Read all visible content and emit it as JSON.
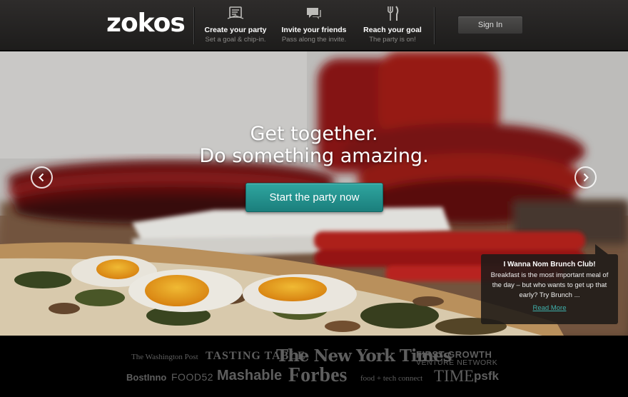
{
  "header": {
    "logo": "zokos",
    "signin_label": "Sign In",
    "steps": [
      {
        "title": "Create your party",
        "subtitle": "Set a goal & chip-in.",
        "icon": "receipt-icon"
      },
      {
        "title": "Invite your friends",
        "subtitle": "Pass along the invite.",
        "icon": "chat-bubble-icon"
      },
      {
        "title": "Reach your goal",
        "subtitle": "The party is on!",
        "icon": "fork-knife-icon"
      }
    ]
  },
  "hero": {
    "headline_line1": "Get together.",
    "headline_line2": "Do something amazing.",
    "cta_label": "Start the party now",
    "popup": {
      "title": "I Wanna Nom Brunch Club!",
      "body": "Breakfast is the most important meal of the day – but who wants to get up that early? Try Brunch ...",
      "link": "Read More"
    }
  },
  "press": {
    "washington_post": "The Washington Post",
    "tasting_table": "TASTING TABLE",
    "nyt": "The New York Times",
    "first_growth_1": "FIRST GROWTH",
    "first_growth_2": "VENTURE NETWORK",
    "bostinno": "BostInno",
    "food52": "FOOD52",
    "mashable": "Mashable",
    "forbes": "Forbes",
    "food_tech": "food + tech connect",
    "time": "TIME",
    "psfk": "psfk"
  },
  "colors": {
    "header_bg": "#262524",
    "accent_teal": "#238f8b",
    "link_teal": "#3fb2ad"
  }
}
